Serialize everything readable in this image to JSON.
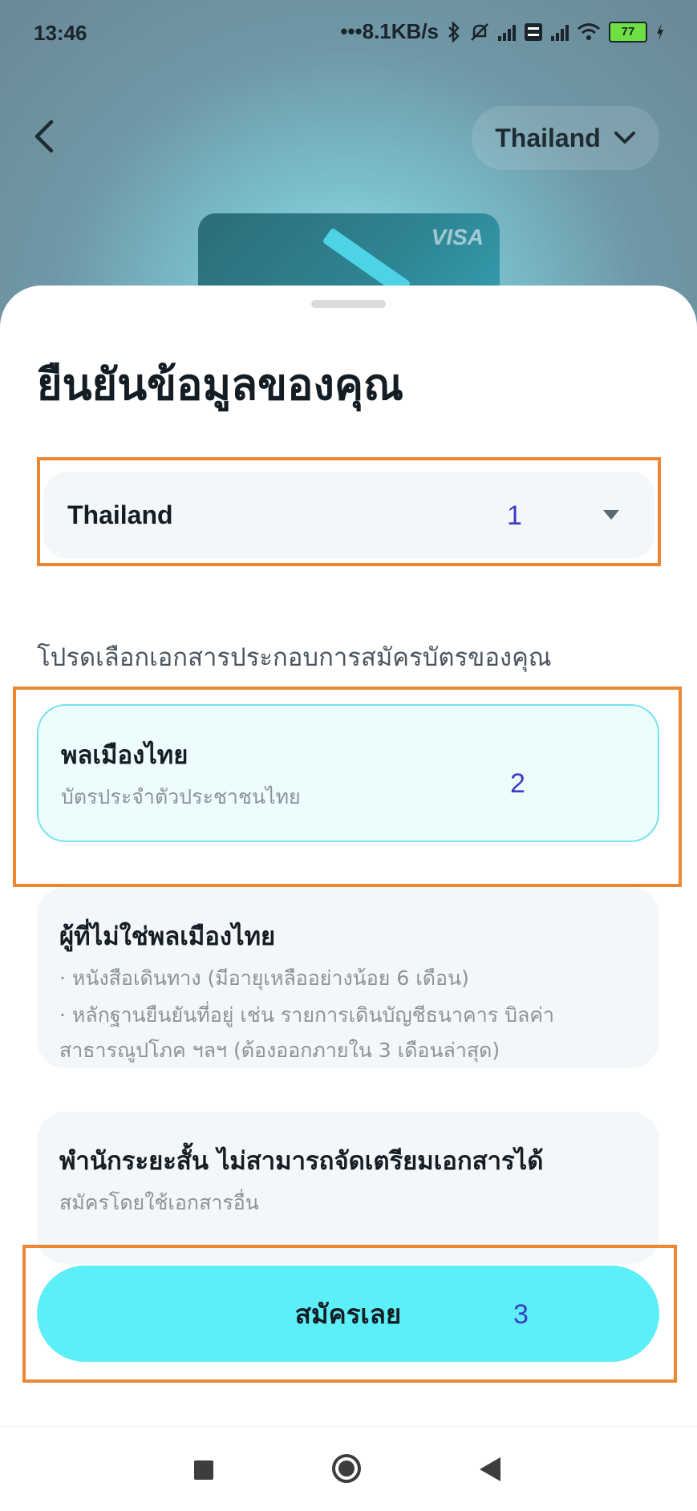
{
  "status_bar": {
    "time": "13:46",
    "net_speed": "•••8.1KB/s",
    "battery": "77"
  },
  "header": {
    "country_label": "Thailand"
  },
  "card_preview": {
    "brand": "VISA"
  },
  "sheet": {
    "title": "ยืนยันข้อมูลของคุณ",
    "country_select": {
      "value": "Thailand"
    },
    "prompt": "โปรดเลือกเอกสารประกอบการสมัครบัตรของคุณ",
    "options": [
      {
        "title": "พลเมืองไทย",
        "lines": [
          "บัตรประจำตัวประชาชนไทย"
        ],
        "selected": true
      },
      {
        "title": "ผู้ที่ไม่ใช่พลเมืองไทย",
        "lines": [
          "· หนังสือเดินทาง (มีอายุเหลืออย่างน้อย 6 เดือน)",
          "· หลักฐานยืนยันที่อยู่ เช่น รายการเดินบัญชีธนาคาร บิลค่าสาธารณูปโภค ฯลฯ (ต้องออกภายใน 3 เดือนล่าสุด)"
        ],
        "selected": false
      },
      {
        "title": "พำนักระยะสั้น ไม่สามารถจัดเตรียมเอกสารได้",
        "lines": [
          "สมัครโดยใช้เอกสารอื่น"
        ],
        "selected": false
      }
    ],
    "submit_label": "สมัครเลย"
  },
  "annotations": {
    "labels": [
      "1",
      "2",
      "3"
    ],
    "box_color": "#ee8733",
    "number_color": "#3c3cc4"
  },
  "colors": {
    "accent": "#5deff7",
    "selected_border": "#77e2ee",
    "text_dark": "#141c24"
  },
  "icons": [
    "chevron-left-icon",
    "chevron-down-icon",
    "caret-down-icon",
    "bluetooth-icon",
    "mute-icon",
    "wifi-icon",
    "battery-icon"
  ]
}
